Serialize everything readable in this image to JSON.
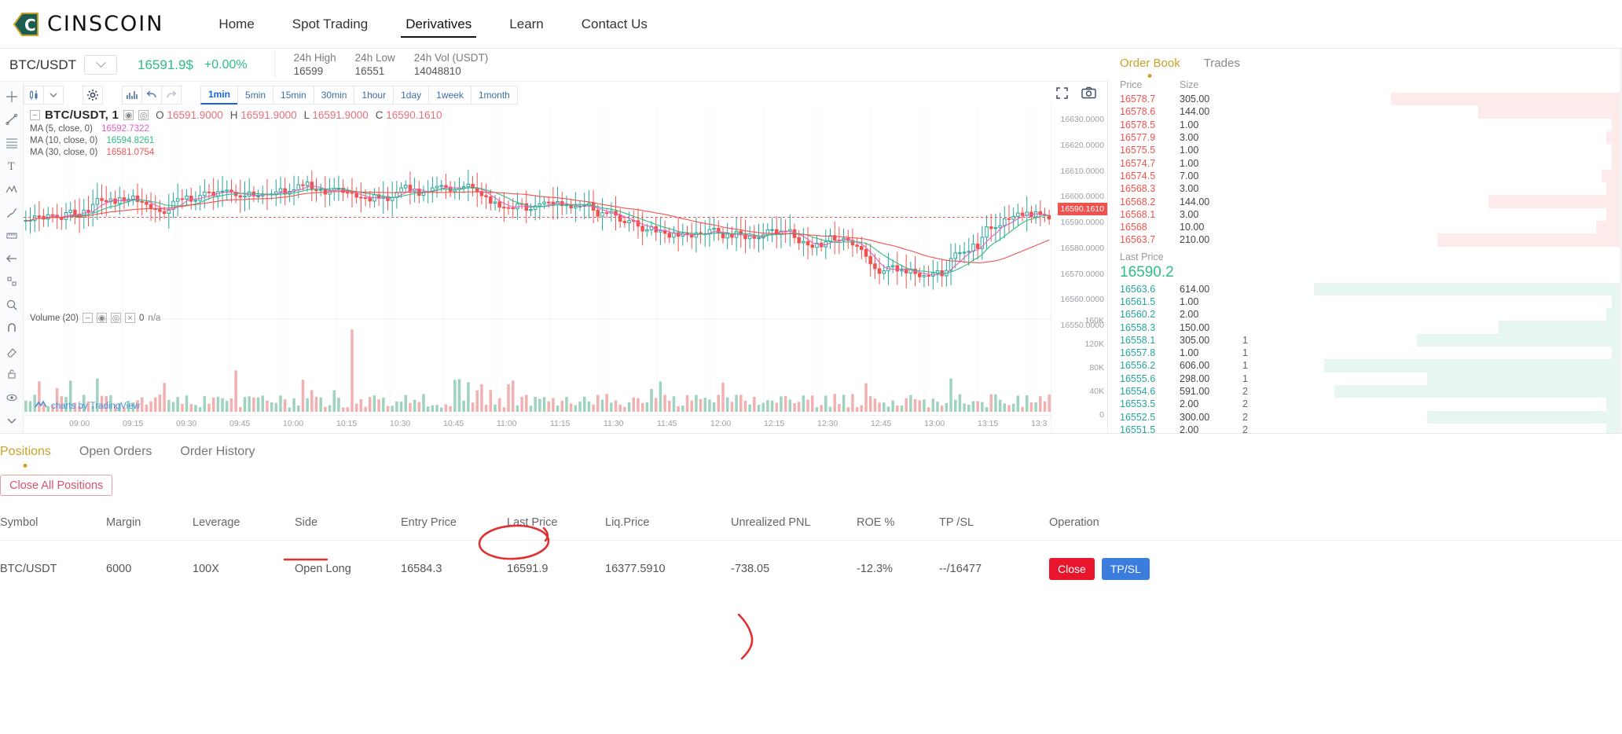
{
  "brand": {
    "name": "CINSCOIN",
    "logo_icon": "cinscoin-logo-icon"
  },
  "nav": {
    "items": [
      {
        "label": "Home",
        "active": false
      },
      {
        "label": "Spot Trading",
        "active": false
      },
      {
        "label": "Derivatives",
        "active": true
      },
      {
        "label": "Learn",
        "active": false
      },
      {
        "label": "Contact Us",
        "active": false
      }
    ]
  },
  "ticker": {
    "symbol": "BTC/USDT",
    "dropdown_icon": "chevron-down-icon",
    "last_price": "16591.9$",
    "change": "+0.00%",
    "stats": [
      {
        "label": "24h High",
        "value": "16599"
      },
      {
        "label": "24h Low",
        "value": "16551"
      },
      {
        "label": "24h Vol (USDT)",
        "value": "14048810"
      }
    ]
  },
  "chart": {
    "toolbar": {
      "candle_icon": "candlestick-icon",
      "caret_icon": "caret-down-icon",
      "settings_icon": "gear-icon",
      "indicator_icon": "indicator-chart-icon",
      "undo_icon": "undo-arrow-icon",
      "redo_icon": "redo-arrow-icon",
      "fullscreen_icon": "fullscreen-icon",
      "camera_icon": "camera-icon",
      "timeframes": [
        {
          "label": "1min",
          "active": true
        },
        {
          "label": "5min",
          "active": false
        },
        {
          "label": "15min",
          "active": false
        },
        {
          "label": "30min",
          "active": false
        },
        {
          "label": "1hour",
          "active": false
        },
        {
          "label": "1day",
          "active": false
        },
        {
          "label": "1week",
          "active": false
        },
        {
          "label": "1month",
          "active": false
        }
      ]
    },
    "tool_rail": [
      "crosshair-icon",
      "trendline-icon",
      "fib-icon",
      "text-icon",
      "pattern-icon",
      "brush-icon",
      "ruler-icon",
      "arrow-left-icon",
      "scale-icon",
      "zoom-icon",
      "magnet-icon",
      "eraser-icon",
      "lock-icon",
      "eye-icon",
      "chevron-down-icon"
    ],
    "legend": {
      "collapse_icon": "collapse-icon",
      "title": "BTC/USDT, 1",
      "eye_icon": "eye-icon",
      "settings_icon": "settings-dot-icon",
      "o_label": "O",
      "o_value": "16591.9000",
      "h_label": "H",
      "h_value": "16591.9000",
      "l_label": "L",
      "l_value": "16591.9000",
      "c_label": "C",
      "c_value": "16590.1610",
      "ma": [
        {
          "label": "MA (5, close, 0)",
          "value": "16592.7322",
          "color": "#e060c0"
        },
        {
          "label": "MA (10, close, 0)",
          "value": "16594.8261",
          "color": "#2ebd85"
        },
        {
          "label": "MA (30, close, 0)",
          "value": "16581.0754",
          "color": "#ef5350"
        }
      ]
    },
    "price_ticks": [
      "16630.0000",
      "16620.0000",
      "16610.0000",
      "16600.0000",
      "16590.0000",
      "16580.0000",
      "16570.0000",
      "16560.0000",
      "16550.0000"
    ],
    "current_price_tag": "16590.1610",
    "time_ticks": [
      "09:00",
      "09:15",
      "09:30",
      "09:45",
      "10:00",
      "10:15",
      "10:30",
      "10:45",
      "11:00",
      "11:15",
      "11:30",
      "11:45",
      "12:00",
      "12:15",
      "12:30",
      "12:45",
      "13:00",
      "13:15",
      "13:3"
    ],
    "volume": {
      "label": "Volume (20)",
      "value": "0",
      "na": "n/a",
      "ticks": [
        "160K",
        "120K",
        "80K",
        "40K",
        "0"
      ]
    },
    "attribution": "charts by TradingView",
    "attribution_icon": "tradingview-icon"
  },
  "orderbook": {
    "tabs": [
      {
        "label": "Order Book",
        "active": true
      },
      {
        "label": "Trades",
        "active": false
      }
    ],
    "headers": {
      "price": "Price",
      "size": "Size"
    },
    "asks": [
      {
        "price": "16578.7",
        "size": "305.00",
        "depth": 45
      },
      {
        "price": "16578.6",
        "size": "144.00",
        "depth": 28
      },
      {
        "price": "16578.5",
        "size": "1.00",
        "depth": 2
      },
      {
        "price": "16577.9",
        "size": "3.00",
        "depth": 3
      },
      {
        "price": "16575.5",
        "size": "1.00",
        "depth": 2
      },
      {
        "price": "16574.7",
        "size": "1.00",
        "depth": 2
      },
      {
        "price": "16574.5",
        "size": "7.00",
        "depth": 4
      },
      {
        "price": "16568.3",
        "size": "3.00",
        "depth": 3
      },
      {
        "price": "16568.2",
        "size": "144.00",
        "depth": 26
      },
      {
        "price": "16568.1",
        "size": "3.00",
        "depth": 3
      },
      {
        "price": "16568",
        "size": "10.00",
        "depth": 5
      },
      {
        "price": "16563.7",
        "size": "210.00",
        "depth": 36
      }
    ],
    "last": {
      "label": "Last Price",
      "value": "16590.2"
    },
    "bids": [
      {
        "price": "16563.6",
        "size": "614.00",
        "extra": "",
        "depth": 60
      },
      {
        "price": "16561.5",
        "size": "1.00",
        "extra": "",
        "depth": 2
      },
      {
        "price": "16560.2",
        "size": "2.00",
        "extra": "",
        "depth": 3
      },
      {
        "price": "16558.3",
        "size": "150.00",
        "extra": "",
        "depth": 24
      },
      {
        "price": "16558.1",
        "size": "305.00",
        "extra": "1",
        "depth": 40
      },
      {
        "price": "16557.8",
        "size": "1.00",
        "extra": "1",
        "depth": 2
      },
      {
        "price": "16556.2",
        "size": "606.00",
        "extra": "1",
        "depth": 58
      },
      {
        "price": "16555.6",
        "size": "298.00",
        "extra": "1",
        "depth": 38
      },
      {
        "price": "16554.6",
        "size": "591.00",
        "extra": "2",
        "depth": 56
      },
      {
        "price": "16553.5",
        "size": "2.00",
        "extra": "2",
        "depth": 3
      },
      {
        "price": "16552.5",
        "size": "300.00",
        "extra": "2",
        "depth": 38
      },
      {
        "price": "16551.5",
        "size": "2.00",
        "extra": "2",
        "depth": 3
      }
    ]
  },
  "bottom": {
    "tabs": [
      {
        "label": "Positions",
        "active": true
      },
      {
        "label": "Open Orders",
        "active": false
      },
      {
        "label": "Order History",
        "active": false
      }
    ],
    "close_all_label": "Close All Positions",
    "columns": [
      "Symbol",
      "Margin",
      "Leverage",
      "Side",
      "Entry Price",
      "Last Price",
      "Liq.Price",
      "Unrealized PNL",
      "ROE %",
      "TP /SL",
      "Operation"
    ],
    "rows": [
      {
        "symbol": "BTC/USDT",
        "margin": "6000",
        "leverage": "100X",
        "side": "Open Long",
        "entry_price": "16584.3",
        "last_price": "16591.9",
        "liq_price": "16377.5910",
        "unrealized_pnl": "-738.05",
        "roe": "-12.3%",
        "tp_sl": "--/16477",
        "close_label": "Close",
        "tpsl_label": "TP/SL"
      }
    ]
  },
  "colors": {
    "green": "#2ebd85",
    "red": "#ef5350",
    "gold": "#c9a227",
    "blue": "#3b7ddd",
    "annotation_red": "#e03030"
  }
}
